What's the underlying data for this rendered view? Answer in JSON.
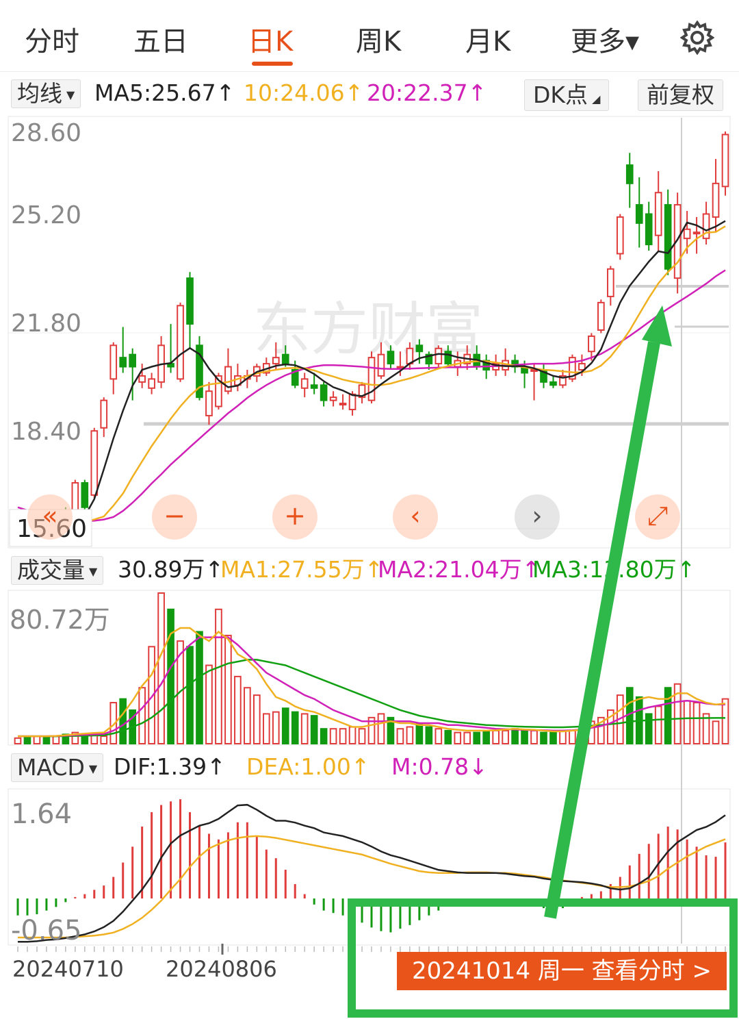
{
  "tabs": {
    "items": [
      {
        "label": "分时",
        "active": false
      },
      {
        "label": "五日",
        "active": false
      },
      {
        "label": "日K",
        "active": true
      },
      {
        "label": "周K",
        "active": false
      },
      {
        "label": "月K",
        "active": false
      },
      {
        "label": "更多▾",
        "active": false
      }
    ],
    "settings_icon": "gear-icon"
  },
  "ma_row": {
    "selector": "均线",
    "ma5": "MA5:25.67",
    "ma10": "10:24.06",
    "ma20": "20:22.37",
    "dk_label": "DK点",
    "fq_label": "前复权"
  },
  "vol_row": {
    "selector": "成交量",
    "vol": "30.89万",
    "ma1": "MA1:27.55万",
    "ma2": "MA2:21.04万",
    "ma3": "MA3:13.80万"
  },
  "macd_row": {
    "selector": "MACD",
    "dif": "DIF:1.39",
    "dea": "DEA:1.00",
    "m": "M:0.78"
  },
  "colors": {
    "up": "#e03c3c",
    "down": "#119a11",
    "ma5": "#222222",
    "ma10": "#f0b020",
    "ma20": "#d020b8",
    "vol_ma3": "#11a011",
    "accent": "#e8501a",
    "annotation": "#2fb94a"
  },
  "watermark": "东方财富",
  "price_axis": {
    "labels": [
      "28.60",
      "25.20",
      "21.80",
      "18.40",
      "15.60"
    ]
  },
  "volume_axis": {
    "label": "80.72万"
  },
  "macd_axis": {
    "labels": [
      "1.64",
      "-0.65"
    ]
  },
  "date_axis": {
    "labels": [
      "20240710",
      "20240806"
    ]
  },
  "selected_bar": {
    "label": "20241014 周一  查看分时 >"
  },
  "controls": {
    "icons": [
      "rewind-icon",
      "zoom-out-icon",
      "zoom-in-icon",
      "prev-icon",
      "next-icon",
      "fullscreen-icon"
    ]
  },
  "chart_data": [
    {
      "type": "candlestick",
      "title": "",
      "ylim": [
        15.6,
        28.6
      ],
      "ohlc": [
        [
          15.6,
          15.8,
          15.3,
          15.7
        ],
        [
          15.7,
          15.9,
          15.5,
          15.6
        ],
        [
          15.6,
          16.0,
          15.5,
          15.9
        ],
        [
          15.9,
          16.1,
          15.6,
          15.7
        ],
        [
          15.6,
          16.0,
          15.5,
          15.9
        ],
        [
          15.9,
          16.3,
          15.4,
          15.5
        ],
        [
          15.7,
          17.2,
          15.6,
          17.1
        ],
        [
          17.1,
          17.2,
          16.0,
          16.3
        ],
        [
          16.7,
          18.9,
          16.6,
          18.8
        ],
        [
          18.9,
          19.9,
          18.6,
          19.8
        ],
        [
          20.5,
          21.7,
          20.0,
          21.6
        ],
        [
          21.2,
          22.2,
          20.7,
          20.9
        ],
        [
          21.3,
          21.5,
          19.8,
          20.9
        ],
        [
          20.4,
          21.0,
          20.2,
          20.6
        ],
        [
          20.2,
          20.7,
          20.0,
          20.5
        ],
        [
          20.4,
          21.9,
          20.2,
          21.6
        ],
        [
          21.0,
          22.3,
          20.7,
          20.9
        ],
        [
          20.5,
          23.0,
          20.4,
          22.9
        ],
        [
          23.8,
          24.0,
          21.5,
          22.3
        ],
        [
          21.6,
          21.9,
          19.8,
          19.9
        ],
        [
          19.3,
          20.4,
          19.0,
          20.1
        ],
        [
          19.6,
          20.7,
          19.5,
          20.6
        ],
        [
          20.1,
          21.5,
          20.0,
          20.9
        ],
        [
          20.3,
          21.0,
          20.1,
          20.6
        ],
        [
          20.5,
          20.8,
          20.2,
          20.6
        ],
        [
          20.6,
          21.0,
          20.4,
          20.9
        ],
        [
          20.7,
          21.2,
          20.6,
          21.0
        ],
        [
          21.0,
          21.7,
          20.8,
          21.2
        ],
        [
          21.3,
          21.6,
          20.9,
          21.0
        ],
        [
          20.8,
          21.1,
          20.2,
          20.3
        ],
        [
          20.2,
          20.7,
          19.9,
          20.5
        ],
        [
          20.3,
          20.7,
          20.0,
          20.2
        ],
        [
          20.3,
          20.4,
          19.6,
          19.8
        ],
        [
          19.8,
          20.1,
          19.6,
          19.9
        ],
        [
          19.7,
          20.0,
          19.5,
          19.7
        ],
        [
          19.5,
          20.1,
          19.3,
          20.0
        ],
        [
          19.9,
          20.4,
          19.7,
          20.3
        ],
        [
          19.8,
          21.4,
          19.7,
          21.2
        ],
        [
          20.6,
          21.7,
          20.5,
          21.3
        ],
        [
          21.4,
          21.6,
          20.8,
          21.0
        ],
        [
          20.9,
          21.4,
          20.6,
          20.9
        ],
        [
          21.0,
          21.7,
          20.8,
          21.5
        ],
        [
          21.6,
          21.8,
          21.0,
          21.4
        ],
        [
          21.3,
          21.4,
          20.8,
          21.0
        ],
        [
          21.0,
          21.6,
          20.9,
          21.5
        ],
        [
          21.4,
          21.6,
          20.9,
          21.0
        ],
        [
          20.9,
          21.4,
          20.6,
          21.1
        ],
        [
          21.0,
          21.6,
          20.8,
          21.3
        ],
        [
          21.3,
          21.6,
          20.8,
          20.9
        ],
        [
          21.1,
          21.3,
          20.5,
          20.8
        ],
        [
          20.8,
          21.3,
          20.6,
          21.0
        ],
        [
          20.8,
          21.5,
          20.6,
          21.1
        ],
        [
          21.1,
          21.3,
          20.7,
          20.9
        ],
        [
          20.9,
          21.1,
          20.2,
          20.7
        ],
        [
          20.8,
          21.0,
          19.8,
          20.8
        ],
        [
          20.8,
          21.0,
          20.2,
          20.4
        ],
        [
          20.4,
          20.6,
          20.2,
          20.3
        ],
        [
          20.3,
          20.8,
          20.2,
          20.6
        ],
        [
          20.5,
          21.3,
          20.4,
          21.2
        ],
        [
          20.8,
          21.3,
          20.6,
          21.0
        ],
        [
          21.4,
          22.0,
          21.1,
          21.9
        ],
        [
          22.1,
          23.1,
          22.0,
          23.0
        ],
        [
          23.2,
          24.2,
          22.9,
          24.1
        ],
        [
          24.6,
          25.9,
          24.4,
          25.8
        ],
        [
          27.5,
          27.9,
          26.1,
          26.9
        ],
        [
          26.2,
          27.1,
          24.8,
          25.6
        ],
        [
          25.9,
          26.3,
          24.7,
          24.9
        ],
        [
          25.2,
          27.3,
          24.7,
          26.6
        ],
        [
          26.2,
          26.7,
          23.9,
          24.1
        ],
        [
          23.8,
          26.6,
          23.3,
          26.2
        ],
        [
          25.1,
          26.0,
          24.6,
          25.4
        ],
        [
          25.3,
          25.8,
          24.6,
          25.3
        ],
        [
          25.1,
          26.3,
          24.9,
          25.9
        ],
        [
          25.8,
          27.7,
          25.3,
          26.9
        ],
        [
          26.8,
          28.6,
          26.5,
          28.5
        ]
      ],
      "ma5": [
        15.95,
        15.85,
        15.8,
        15.73,
        15.75,
        15.78,
        15.77,
        16.0,
        16.57,
        17.55,
        18.55,
        19.46,
        20.28,
        20.8,
        20.9,
        20.98,
        21.02,
        21.3,
        21.51,
        21.31,
        20.84,
        20.46,
        20.23,
        20.28,
        20.52,
        20.73,
        20.83,
        20.93,
        20.98,
        20.95,
        20.83,
        20.66,
        20.43,
        20.23,
        20.12,
        19.97,
        19.94,
        20.08,
        20.33,
        20.55,
        20.76,
        21.01,
        21.18,
        21.25,
        21.32,
        21.3,
        21.21,
        21.16,
        21.13,
        21.03,
        20.95,
        20.92,
        20.92,
        20.92,
        20.85,
        20.73,
        20.6,
        20.54,
        20.59,
        20.73,
        21.02,
        21.47,
        22.24,
        23.0,
        23.55,
        23.94,
        24.34,
        24.68,
        24.62,
        25.06,
        25.62,
        25.53,
        25.36,
        25.49,
        25.67
      ],
      "ma10": [
        15.5,
        15.6,
        15.67,
        15.71,
        15.74,
        15.77,
        15.8,
        15.83,
        15.9,
        16.0,
        16.35,
        16.75,
        17.3,
        17.8,
        18.3,
        18.75,
        19.2,
        19.6,
        19.95,
        20.23,
        20.32,
        20.36,
        20.4,
        20.5,
        20.6,
        20.68,
        20.75,
        20.8,
        20.85,
        20.86,
        20.85,
        20.78,
        20.67,
        20.58,
        20.48,
        20.41,
        20.36,
        20.31,
        20.3,
        20.35,
        20.44,
        20.52,
        20.62,
        20.73,
        20.84,
        20.92,
        21.0,
        21.05,
        21.08,
        21.08,
        21.04,
        20.99,
        20.93,
        20.88,
        20.84,
        20.8,
        20.78,
        20.75,
        20.72,
        20.71,
        20.77,
        20.94,
        21.23,
        21.63,
        22.09,
        22.62,
        23.15,
        23.63,
        24.0,
        24.31,
        24.8,
        25.09,
        25.29,
        25.31,
        25.5
      ],
      "ma20": [
        16.3,
        16.2,
        16.1,
        16.0,
        15.95,
        15.9,
        15.87,
        15.85,
        15.86,
        15.9,
        15.98,
        16.18,
        16.45,
        16.75,
        17.08,
        17.38,
        17.7,
        17.98,
        18.27,
        18.55,
        18.83,
        19.1,
        19.38,
        19.62,
        19.88,
        20.1,
        20.3,
        20.47,
        20.62,
        20.74,
        20.84,
        20.91,
        20.95,
        20.95,
        20.94,
        20.92,
        20.9,
        20.87,
        20.84,
        20.83,
        20.83,
        20.84,
        20.85,
        20.86,
        20.87,
        20.88,
        20.88,
        20.89,
        20.9,
        20.91,
        20.92,
        20.94,
        20.96,
        20.98,
        21.0,
        21.0,
        21.0,
        21.02,
        21.05,
        21.1,
        21.2,
        21.32,
        21.5,
        21.7,
        21.91,
        22.13,
        22.36,
        22.59,
        22.8,
        23.0,
        23.2,
        23.41,
        23.62,
        23.86,
        24.06
      ]
    },
    {
      "type": "bar",
      "title": "成交量",
      "ymax_label": "80.72万",
      "ylim": [
        0,
        80.72
      ],
      "series_volume": [
        3,
        4,
        4,
        4,
        4,
        5,
        6,
        5,
        5,
        4,
        22,
        24,
        18,
        30,
        52,
        80.72,
        72,
        55,
        52,
        60,
        42,
        72,
        58,
        36,
        30,
        26,
        16,
        17,
        19,
        17,
        16,
        15,
        8,
        8,
        8,
        9,
        8,
        14,
        16,
        14,
        8,
        9,
        11,
        9,
        8,
        7,
        6,
        6,
        6,
        7,
        7,
        7,
        8,
        7,
        7,
        6,
        6,
        7,
        7,
        8,
        12,
        14,
        18,
        26,
        30,
        25,
        16,
        20,
        30,
        32,
        23,
        22,
        16,
        12,
        24
      ],
      "vol_ma1": [
        4,
        4,
        4,
        4,
        4.2,
        4.6,
        5,
        5.4,
        5.8,
        6,
        10,
        16,
        23,
        31,
        37,
        48,
        59,
        62,
        62,
        58,
        55,
        60,
        56,
        48,
        45,
        40,
        32,
        25,
        23,
        20,
        18,
        17,
        15,
        13,
        11,
        9,
        9,
        10,
        11,
        12,
        11,
        11,
        10,
        10,
        9,
        8,
        7.5,
        7,
        7,
        7,
        7.2,
        7.6,
        8,
        7.6,
        7.4,
        7,
        6.6,
        6.6,
        7,
        7.5,
        9,
        11.5,
        14.5,
        18,
        22,
        24,
        25,
        24,
        24,
        27,
        27,
        24,
        22,
        21,
        21.5
      ],
      "vol_ma2": [
        4,
        4,
        4,
        4,
        4.1,
        4.3,
        4.6,
        4.8,
        5,
        5.2,
        7,
        10,
        14,
        19,
        25,
        32,
        41,
        48,
        53,
        57,
        57,
        57,
        57,
        53,
        48,
        43,
        38,
        35,
        32,
        29,
        26,
        24,
        21,
        18,
        16,
        14,
        12,
        12,
        12,
        12,
        12,
        12,
        11,
        11,
        11,
        10,
        10,
        9.5,
        9,
        8.5,
        8,
        7.8,
        7.6,
        7.4,
        7.2,
        7.2,
        7,
        7,
        7.2,
        7.6,
        8.5,
        9.5,
        11,
        13.5,
        16,
        18,
        19.5,
        20.5,
        21.5,
        22.5,
        23,
        22.5,
        21.5,
        21,
        21.04
      ],
      "vol_ma3": [
        4,
        4,
        4,
        4,
        4,
        4.1,
        4.2,
        4.3,
        4.4,
        4.5,
        5.5,
        7,
        9,
        11,
        14,
        18,
        23,
        28,
        32,
        36,
        39,
        41,
        43,
        44,
        45,
        45,
        44,
        43,
        42,
        40,
        38,
        36,
        34,
        32,
        30,
        28,
        26,
        24,
        22,
        20,
        18,
        16.5,
        15,
        14,
        13,
        12,
        11.5,
        11,
        10.5,
        10,
        9.8,
        9.5,
        9.3,
        9.1,
        9,
        8.9,
        8.8,
        8.8,
        9,
        9.2,
        9.6,
        10,
        10.5,
        11,
        11.8,
        12.3,
        12.6,
        12.9,
        13.1,
        13.4,
        13.6,
        13.7,
        13.75,
        13.78,
        13.8
      ]
    },
    {
      "type": "line",
      "title": "MACD",
      "ylim": [
        -0.65,
        1.64
      ],
      "dif": [
        -0.67,
        -0.67,
        -0.66,
        -0.64,
        -0.63,
        -0.61,
        -0.58,
        -0.55,
        -0.5,
        -0.43,
        -0.33,
        -0.18,
        0.0,
        0.18,
        0.4,
        0.7,
        0.93,
        1.06,
        1.14,
        1.22,
        1.26,
        1.33,
        1.44,
        1.55,
        1.56,
        1.48,
        1.38,
        1.3,
        1.3,
        1.27,
        1.22,
        1.18,
        1.11,
        1.08,
        1.05,
        1.0,
        0.95,
        0.88,
        0.8,
        0.74,
        0.7,
        0.65,
        0.6,
        0.55,
        0.5,
        0.48,
        0.46,
        0.45,
        0.45,
        0.45,
        0.45,
        0.44,
        0.42,
        0.4,
        0.39,
        0.36,
        0.34,
        0.32,
        0.31,
        0.3,
        0.28,
        0.25,
        0.2,
        0.18,
        0.2,
        0.28,
        0.38,
        0.6,
        0.8,
        0.95,
        1.05,
        1.15,
        1.2,
        1.28,
        1.39
      ],
      "dea": [
        -0.6,
        -0.6,
        -0.6,
        -0.6,
        -0.6,
        -0.6,
        -0.59,
        -0.58,
        -0.57,
        -0.55,
        -0.52,
        -0.46,
        -0.38,
        -0.28,
        -0.15,
        0.0,
        0.18,
        0.35,
        0.55,
        0.72,
        0.85,
        0.92,
        0.98,
        1.02,
        1.04,
        1.05,
        1.04,
        1.02,
        0.99,
        0.96,
        0.93,
        0.9,
        0.87,
        0.84,
        0.81,
        0.78,
        0.75,
        0.7,
        0.65,
        0.6,
        0.56,
        0.52,
        0.48,
        0.46,
        0.45,
        0.45,
        0.45,
        0.46,
        0.46,
        0.46,
        0.45,
        0.45,
        0.44,
        0.42,
        0.4,
        0.38,
        0.35,
        0.33,
        0.31,
        0.29,
        0.27,
        0.24,
        0.22,
        0.22,
        0.23,
        0.27,
        0.32,
        0.4,
        0.52,
        0.62,
        0.72,
        0.8,
        0.88,
        0.94,
        1.0
      ],
      "histogram": [
        -0.14,
        -0.14,
        -0.13,
        -0.1,
        -0.07,
        -0.03,
        0.02,
        0.06,
        0.12,
        0.18,
        0.3,
        0.5,
        0.72,
        1.0,
        1.2,
        1.3,
        1.35,
        1.38,
        1.2,
        1.02,
        0.9,
        0.82,
        0.92,
        1.06,
        1.06,
        0.86,
        0.68,
        0.56,
        0.4,
        0.2,
        0.06,
        -0.05,
        -0.1,
        -0.12,
        -0.14,
        -0.17,
        -0.2,
        -0.24,
        -0.27,
        -0.28,
        -0.25,
        -0.22,
        -0.18,
        -0.14,
        -0.1,
        -0.06,
        -0.04,
        -0.03,
        -0.02,
        -0.02,
        -0.01,
        -0.01,
        -0.02,
        -0.04,
        -0.05,
        -0.08,
        -0.1,
        -0.08,
        -0.05,
        0.02,
        0.06,
        0.1,
        0.2,
        0.3,
        0.46,
        0.62,
        0.76,
        0.9,
        1.0,
        0.96,
        0.82,
        0.72,
        0.6,
        0.58,
        0.78
      ]
    }
  ]
}
